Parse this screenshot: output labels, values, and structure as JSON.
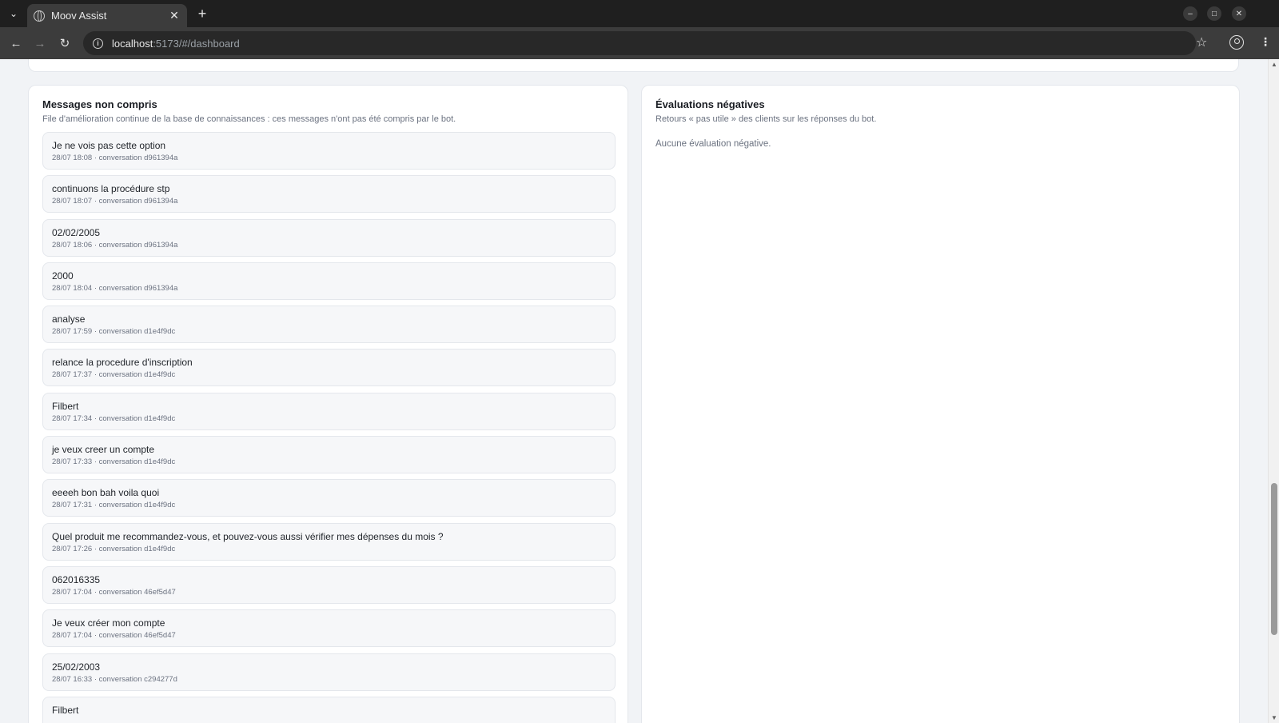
{
  "browser": {
    "tab_title": "Moov Assist",
    "url_host": "localhost",
    "url_path": ":5173/#/dashboard"
  },
  "unrecognized": {
    "title": "Messages non compris",
    "subtitle": "File d'amélioration continue de la base de connaissances : ces messages n'ont pas été compris par le bot.",
    "items": [
      {
        "text": "Je ne vois pas cette option",
        "meta": "28/07 18:08 · conversation d961394a"
      },
      {
        "text": "continuons la procédure stp",
        "meta": "28/07 18:07 · conversation d961394a"
      },
      {
        "text": "02/02/2005",
        "meta": "28/07 18:06 · conversation d961394a"
      },
      {
        "text": "2000",
        "meta": "28/07 18:04 · conversation d961394a"
      },
      {
        "text": "analyse",
        "meta": "28/07 17:59 · conversation d1e4f9dc"
      },
      {
        "text": "relance la procedure d'inscription",
        "meta": "28/07 17:37 · conversation d1e4f9dc"
      },
      {
        "text": "Filbert",
        "meta": "28/07 17:34 · conversation d1e4f9dc"
      },
      {
        "text": "je veux creer un compte",
        "meta": "28/07 17:33 · conversation d1e4f9dc"
      },
      {
        "text": "eeeeh bon bah voila quoi",
        "meta": "28/07 17:31 · conversation d1e4f9dc"
      },
      {
        "text": "Quel produit me recommandez-vous, et pouvez-vous aussi vérifier mes dépenses du mois ?",
        "meta": "28/07 17:26 · conversation d1e4f9dc"
      },
      {
        "text": "062016335",
        "meta": "28/07 17:04 · conversation 46ef5d47"
      },
      {
        "text": "Je veux créer mon compte",
        "meta": "28/07 17:04 · conversation 46ef5d47"
      },
      {
        "text": "25/02/2003",
        "meta": "28/07 16:33 · conversation c294277d"
      },
      {
        "text": "Filbert",
        "meta": ""
      }
    ]
  },
  "negative": {
    "title": "Évaluations négatives",
    "subtitle": "Retours « pas utile » des clients sur les réponses du bot.",
    "empty": "Aucune évaluation négative."
  }
}
